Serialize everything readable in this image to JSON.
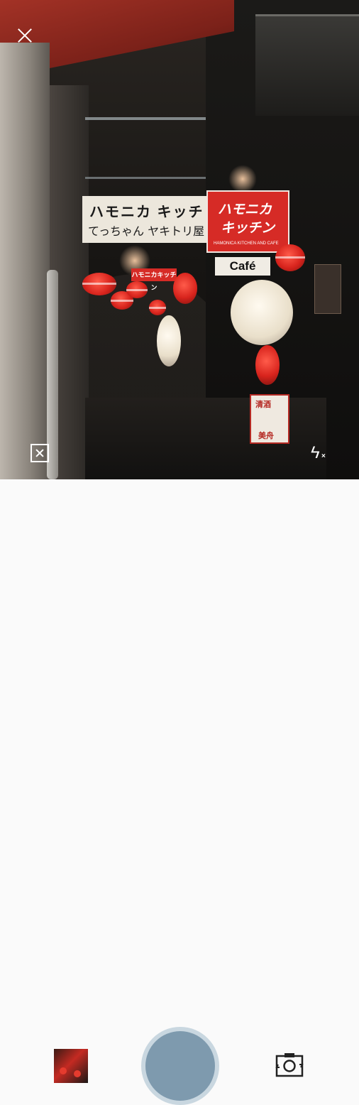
{
  "viewfinder": {
    "signs": {
      "white_line1": "ハモニカ キッチ",
      "white_line2": "てっちゃん ヤキトリ屋",
      "red_line1": "ハモニカ",
      "red_line2": "キッチン",
      "red_small": "HAMONICA KITCHEN AND CAFE",
      "cafe": "Café",
      "small_red": "ハモニカキッチン",
      "vertical_top": "清酒",
      "vertical_bottom": "美舟"
    }
  },
  "overlay": {
    "close_icon": "close-icon",
    "grid_icon": "grid-off-icon",
    "flash_icon": "flash-off-icon"
  },
  "controls": {
    "gallery_icon": "gallery-thumbnail",
    "shutter_color": "#7e9aae",
    "shutter_ring_color": "#c9d7e0",
    "switch_icon": "switch-camera-icon"
  }
}
